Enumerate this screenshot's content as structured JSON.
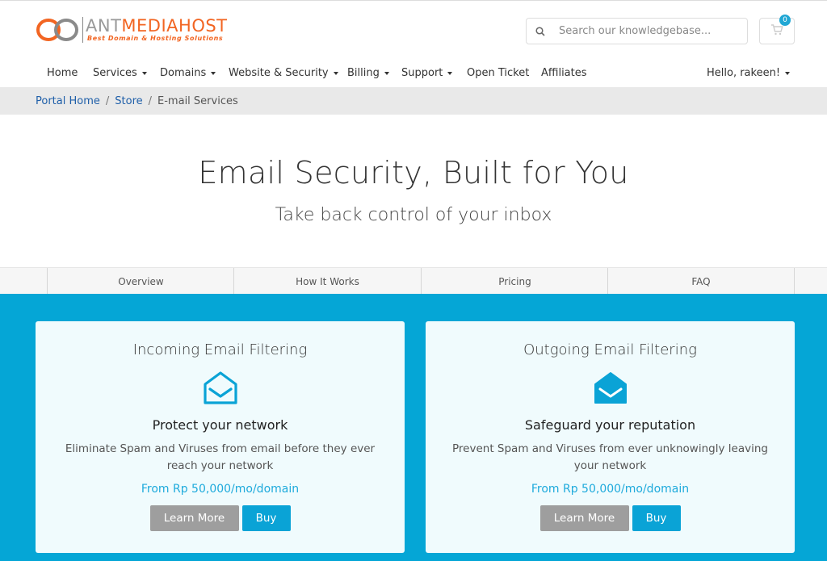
{
  "brand": {
    "name_part1": "ANT",
    "name_part2": "MEDIAHOST",
    "tagline": "Best Domain & Hosting Solutions",
    "colors": {
      "orange": "#f26522",
      "grey": "#9a9a9a"
    }
  },
  "search": {
    "placeholder": "Search our knowledgebase..."
  },
  "cart": {
    "count": "0"
  },
  "nav": {
    "home": "Home",
    "services": "Services",
    "domains": "Domains",
    "website_security": "Website & Security",
    "billing": "Billing",
    "support": "Support",
    "open_ticket": "Open Ticket",
    "affiliates": "Affiliates",
    "user": "Hello, rakeen!"
  },
  "breadcrumb": {
    "portal_home": "Portal Home",
    "store": "Store",
    "current": "E-mail Services",
    "separator": "/"
  },
  "hero": {
    "title": "Email Security, Built for You",
    "subtitle": "Take back control of your inbox"
  },
  "tabs": [
    "Overview",
    "How It Works",
    "Pricing",
    "FAQ"
  ],
  "products": [
    {
      "title": "Incoming Email Filtering",
      "icon": "envelope-open-icon",
      "heading": "Protect your network",
      "description": "Eliminate Spam and Viruses from email before they ever reach your network",
      "price": "From Rp 50,000/mo/domain",
      "learn_more": "Learn More",
      "buy": "Buy"
    },
    {
      "title": "Outgoing Email Filtering",
      "icon": "envelope-solid-icon",
      "heading": "Safeguard your reputation",
      "description": "Prevent Spam and Viruses from ever unknowingly leaving your network",
      "price": "From Rp 50,000/mo/domain",
      "learn_more": "Learn More",
      "buy": "Buy"
    }
  ],
  "colors": {
    "accent_blue": "#05a6d6",
    "link_blue": "#1f5fa9",
    "button_grey": "#9e9e9e"
  }
}
